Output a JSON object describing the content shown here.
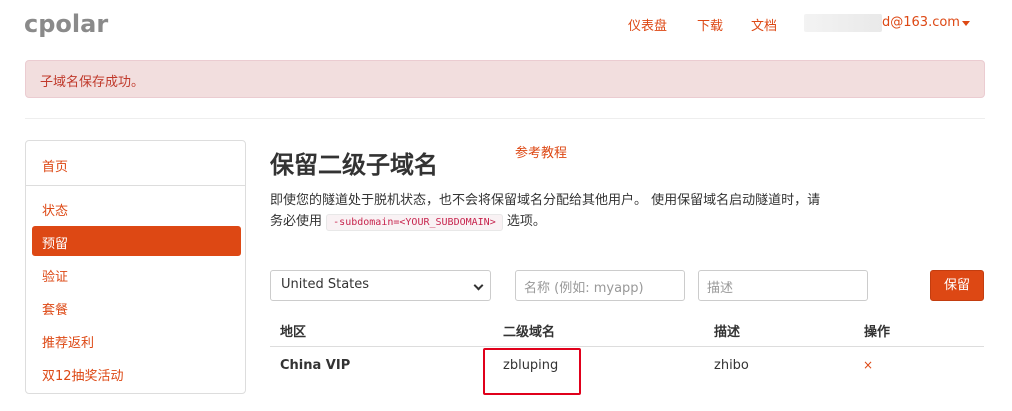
{
  "brand": "cpolar",
  "nav": {
    "dashboard": "仪表盘",
    "download": "下载",
    "docs": "文档",
    "user_email": "d@163.com"
  },
  "alert": "子域名保存成功。",
  "sidebar": {
    "items": [
      {
        "label": "首页"
      },
      {
        "label": "状态"
      },
      {
        "label": "预留"
      },
      {
        "label": "验证"
      },
      {
        "label": "套餐"
      },
      {
        "label": "推荐返利"
      },
      {
        "label": "双12抽奖活动"
      }
    ],
    "active_index": 2
  },
  "main": {
    "title": "保留二级子域名",
    "ref_link": "参考教程",
    "desc_part1": "即使您的隧道处于脱机状态，也不会将保留域名分配给其他用户。 使用保留域名启动隧道时，请务必使用",
    "desc_code": "-subdomain=<YOUR_SUBDOMAIN>",
    "desc_part2": "选项。"
  },
  "form": {
    "region_selected": "United States",
    "name_placeholder": "名称 (例如: myapp)",
    "desc_placeholder": "描述",
    "submit_label": "保留"
  },
  "table": {
    "headers": [
      "地区",
      "二级域名",
      "描述",
      "操作"
    ],
    "rows": [
      {
        "region": "China VIP",
        "subdomain": "zbluping",
        "description": "zhibo",
        "action": "×"
      }
    ]
  },
  "colors": {
    "accent": "#dd4814",
    "alert_bg": "#f2dede",
    "highlight_border": "#e0001b"
  }
}
